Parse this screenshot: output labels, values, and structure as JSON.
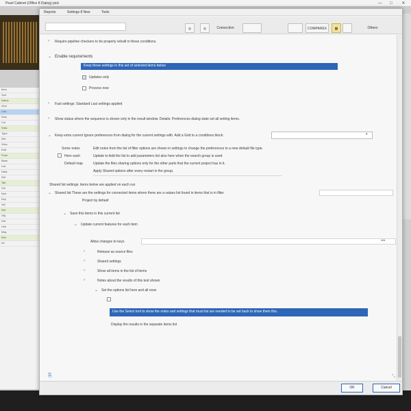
{
  "os": {
    "title": "Pearl Cabinet (Office 8 Dialog) pick",
    "min": "—",
    "max": "□",
    "close": "✕"
  },
  "bg_list_rows": [
    "Item",
    "Sort",
    "Name",
    "Grid",
    "Cell",
    "Row",
    "Col",
    "Data",
    "Type",
    "Ref",
    "View",
    "Edit",
    "Form",
    "Base",
    "List",
    "Data",
    "Set",
    "Tab",
    "Cel",
    "Nod",
    "Key",
    "Val",
    "Ref",
    "Obj",
    "Def",
    "Use",
    "Map",
    "Res",
    "Inf"
  ],
  "dialog": {
    "menus": [
      "Reports",
      "Settings 8 New",
      "Tools"
    ],
    "toolbar": {
      "label1": "Connection",
      "label2": "COMPAREX",
      "label3": "Others",
      "yellow": "▦",
      "icon": "◎"
    },
    "rows": {
      "r1": "Require pipeline checkers to be properly rebuilt in these conditions.",
      "r2": "Enable requirements",
      "blue1": "Keep these settings in this set of selected items below",
      "r3": "Updates only",
      "r4": "Process now",
      "r5": "Fast settings:  Standard   Last settings applied",
      "r6": "Show status where the sequence is shown only in the result window.  Details: Preferences dialog state set all setting items.",
      "r7": "Keep extra  current Ignore preferences from dialog for the current settings with. Add a Grid to a conditions block:",
      "r8": "Some notes  ",
      "r8b": "Edit notes from the list of filter options are shown in settings to change the preferences to a new default file type.",
      "r9": "Here each ",
      "r9b": "Update to Add the list to add parameters list also here when the search group is used",
      "r9c": "Update the files sharing options only for the other parts that the current project has in it.",
      "r10": "Apply  Shared options after every restart in the group.",
      "r11": "Shared list  These are the settings for connected items  where there are a values list found in items that is in filter.",
      "r11b": "Project by default",
      "r12": "Save this items in this current list",
      "r13": "Update current features for each item",
      "r14": "Allow changes to keys",
      "r15": "Release as source files",
      "r16": "Shared settings",
      "r17": "Show all items in the list of items",
      "r18": "Notes about the results of this test shown",
      "r19": "Set the options list here and all rows",
      "blue2": "Use the Select  tool to show the notes and settings that must list are needed to be set back to show them this.",
      "r20": "Display the results in the separate items list"
    },
    "ok": "OK",
    "cancel": "Cancel"
  }
}
